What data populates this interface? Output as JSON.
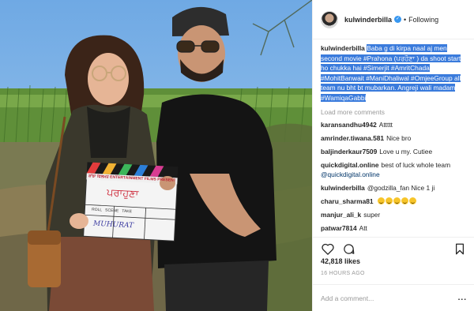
{
  "post": {
    "username": "kulwinderbilla",
    "follow_status": "Following",
    "caption_user": "kulwinderbilla",
    "caption": "Baba g di kirpa naal aj men second movie #Prahona (ਪਰਹੌਣਾ ) da shoot start ho chukka hai #Simerjit #AmritChada #MohitBanwait #ManiDhaliwal #OmjeeGroup all team nu bht bt mubarkan. Angreji wali madam #WamiqaGabbi",
    "load_more": "Load more comments",
    "comments": [
      {
        "user": "karansandhu4942",
        "text": "Attttt"
      },
      {
        "user": "amrinder.tiwana.581",
        "text": "Nice bro"
      },
      {
        "user": "baljinderkaur7509",
        "text": "Love u my. Cutiee"
      },
      {
        "user": "quickdigital.online",
        "text": "best of luck whole team",
        "link": "@quickdigital.online"
      },
      {
        "user": "kulwinderbilla",
        "text": "@godzilla_fan Nice 1 ji"
      },
      {
        "user": "charu_sharma81",
        "text": ""
      },
      {
        "user": "manjur_ali_k",
        "text": "super"
      },
      {
        "user": "patwar7814",
        "text": "Att"
      }
    ],
    "likes": "42,818 likes",
    "time": "16 HOURS AGO",
    "add_comment_placeholder": "Add a comment...",
    "more": "..."
  },
  "photo": {
    "clapper_title": "ਪਰਾਹੁਣਾ",
    "clapper_top": "ਸ਼ਾਂਡਾ ਫਿਲਮਜ਼ ENTERTAINMENT FILMS PRESENT",
    "clapper_line2": "ROLL   SCENE   TAKE",
    "clapper_hand": "MUHURAT"
  },
  "colors": {
    "accent": "#3897f0",
    "selection": "#3a7bdc",
    "muted": "#999999"
  }
}
